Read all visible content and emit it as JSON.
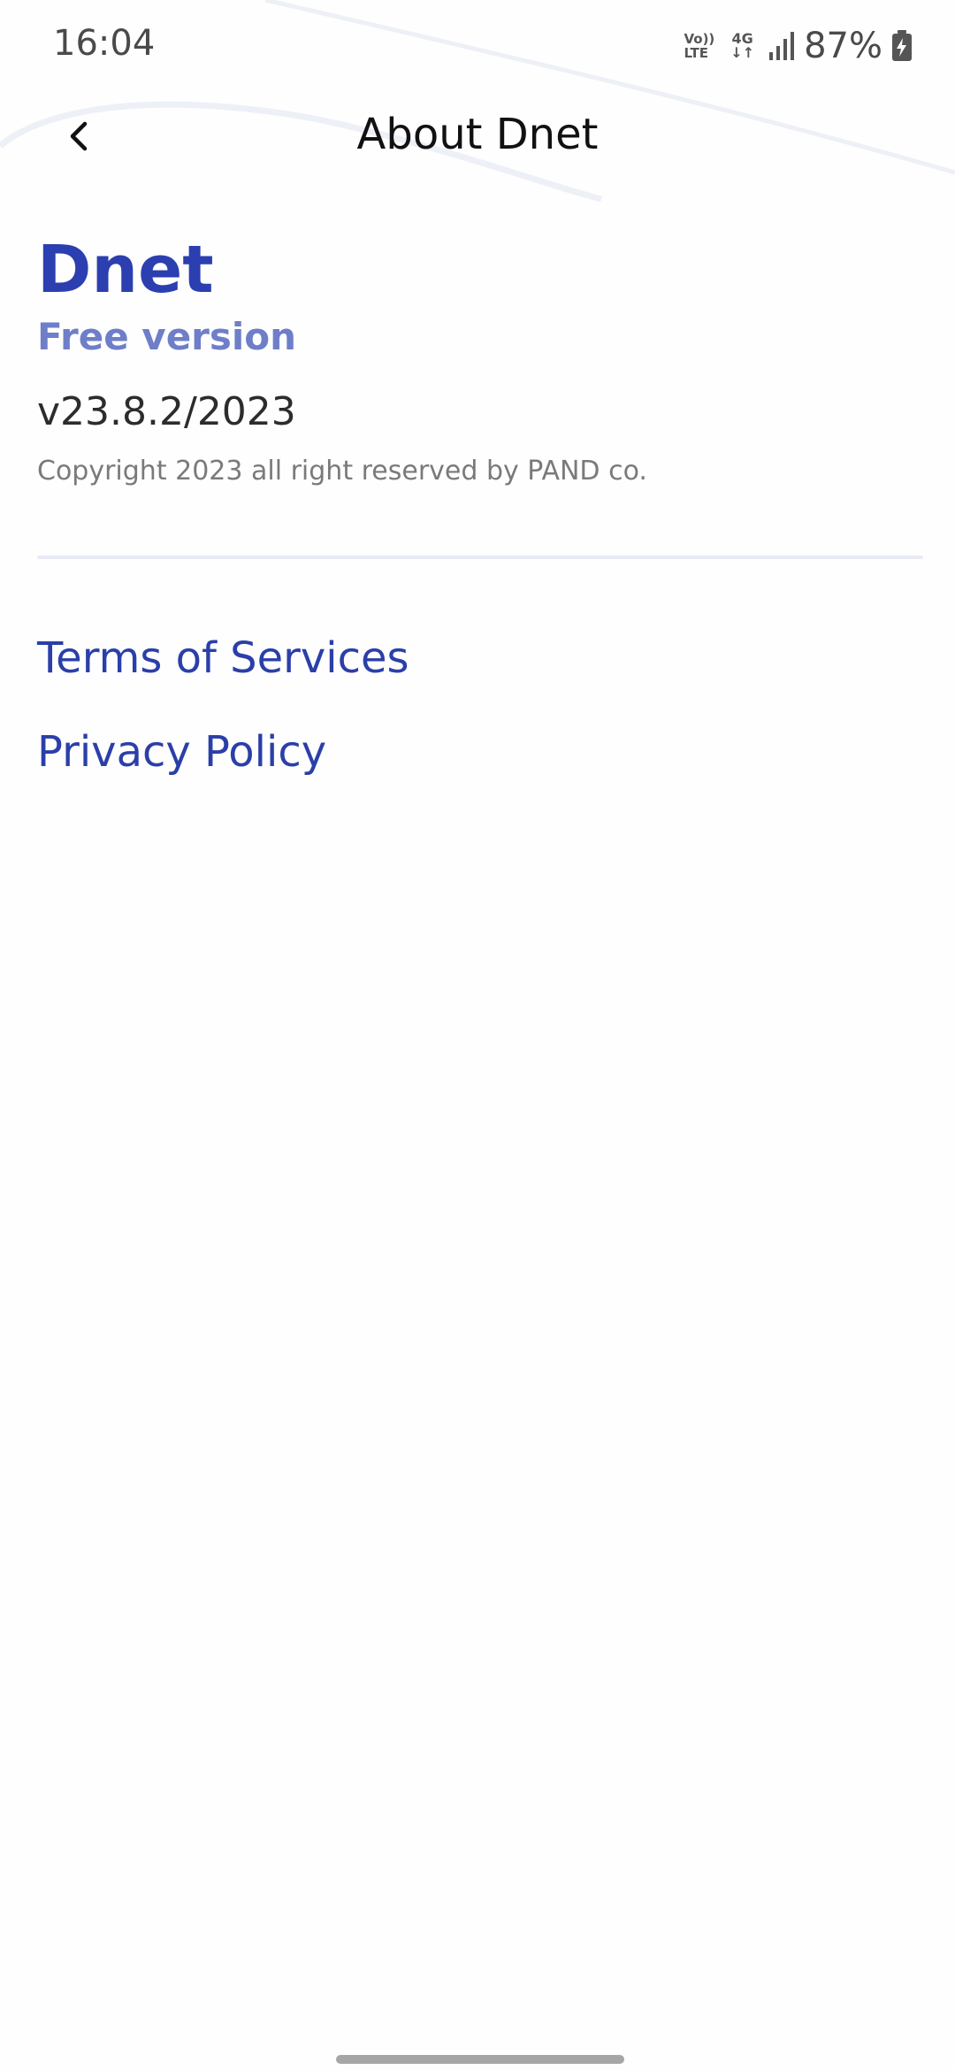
{
  "status_bar": {
    "time": "16:04",
    "volte_top": "Vo))",
    "volte_bottom": "LTE",
    "network": "4G",
    "network_arrows": "↓↑",
    "battery_percent": "87%"
  },
  "header": {
    "title": "About Dnet"
  },
  "about": {
    "app_name": "Dnet",
    "edition": "Free version",
    "version": "v23.8.2/2023",
    "copyright": "Copyright 2023 all right reserved by PAND co."
  },
  "links": {
    "terms": "Terms of Services",
    "privacy": "Privacy Policy"
  },
  "colors": {
    "brand_primary": "#2b3fb0",
    "brand_light": "#6f7ec9",
    "link": "#2b3fa8"
  },
  "icons": {
    "back": "chevron-left-icon",
    "signal": "signal-bars-icon",
    "battery": "battery-charging-icon"
  }
}
